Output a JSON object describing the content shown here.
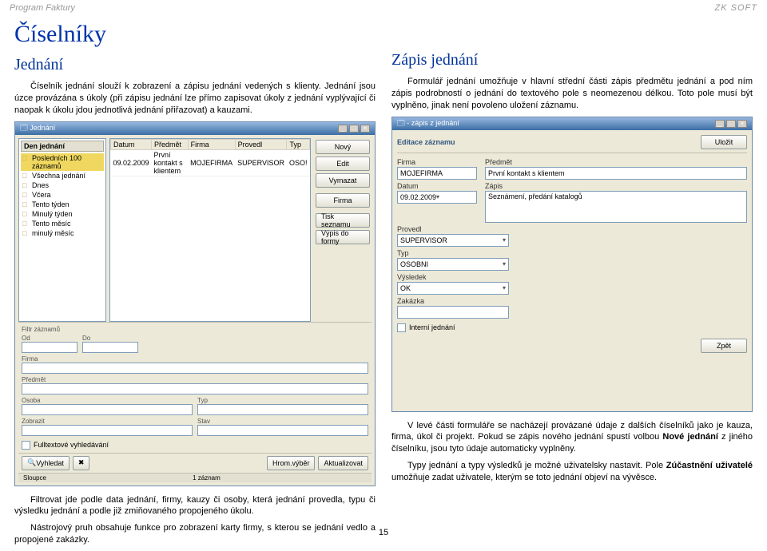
{
  "header": {
    "left": "Program Faktury",
    "right": "ZK SOFT"
  },
  "page_number": "15",
  "left_col": {
    "h1": "Číselníky",
    "h2": "Jednání",
    "p1": "Číselník jednání slouží k zobrazení a zápisu jednání vedených s klienty. Jednání jsou úzce provázána s úkoly (při zápisu jednání lze přímo zapisovat úkoly z jednání vyplývající či naopak k úkolu jdou jednotlivá jednání přiřazovat) a kauzami.",
    "p2": "Filtrovat jde podle data jednání, firmy, kauzy či osoby, která jednání provedla, typu či výsledku jednání a podle již zmiňovaného propojeného úkolu.",
    "p3": "Nástrojový pruh obsahuje funkce pro zobrazení karty firmy, s kterou se jednání vedlo a propojené zakázky."
  },
  "right_col": {
    "h2": "Zápis jednání",
    "p1": "Formulář jednání umožňuje v hlavní střední části zápis předmětu jednání a pod ním zápis podrobností o jednání do textového pole s neomezenou délkou. Toto pole musí být vyplněno, jinak není povoleno uložení záznamu.",
    "p2a": "V levé části formuláře se nacházejí provázané údaje z dalších číselníků jako je kauza, firma, úkol či projekt. Pokud se zápis nového jednání spustí volbou ",
    "p2b": "Nové jednání",
    "p2c": " z jiného číselníku, jsou tyto údaje automaticky vyplněny.",
    "p3a": "Typy jednání a typy výsledků je možné uživatelsky nastavit. Pole ",
    "p3b": "Zúčastnění uživatelé",
    "p3c": " umožňuje zadat uživatele, kterým se toto jednání objeví na vývěsce."
  },
  "win1": {
    "title": "Jednání",
    "tree": {
      "hdr": "Den jednání",
      "items": [
        "Posledních 100 záznamů",
        "Všechna jednání",
        "Dnes",
        "Včera",
        "Tento týden",
        "Minulý týden",
        "Tento měsíc",
        "minulý měsíc"
      ]
    },
    "grid": {
      "headers": [
        "Datum",
        "Předmět",
        "Firma",
        "Provedl",
        "Typ"
      ],
      "row": [
        "09.02.2009",
        "První kontakt s klientem",
        "MOJEFIRMA",
        "SUPERVISOR",
        "OSO!"
      ]
    },
    "sidebtns": [
      "Nový",
      "Edit",
      "Vymazat",
      "Firma",
      "Tisk seznamu",
      "Výpis do formy"
    ],
    "filters": {
      "hdr": "Filtr záznamů",
      "labels": {
        "od": "Od",
        "do": "Do",
        "firma": "Firma",
        "predmet": "Předmět",
        "osoba": "Osoba",
        "typ": "Typ",
        "zobrazit": "Zobrazit",
        "stav": "Stav"
      },
      "fulltext": "Fulltextové vyhledávání"
    },
    "bottom": {
      "vyhledat": "Vyhledat",
      "hromvyber": "Hrom.výběr",
      "aktualizovat": "Aktualizovat"
    },
    "status": {
      "sloupce": "Sloupce",
      "zaznam": "1 záznam"
    }
  },
  "win2": {
    "title": "- zápis z jednání",
    "editace": "Editace záznamu",
    "ulozit": "Uložit",
    "labels": {
      "firma": "Firma",
      "predmet": "Předmět",
      "datum": "Datum",
      "zapis": "Zápis",
      "provedl": "Provedl",
      "typ": "Typ",
      "vysledek": "Výsledek",
      "zakazka": "Zakázka",
      "interni": "Interní jednání",
      "zpet": "Zpět"
    },
    "values": {
      "firma": "MOJEFIRMA",
      "predmet": "První kontakt s klientem",
      "datum": "09.02.2009",
      "zapis": "Seznámení, předání katalogů",
      "provedl": "SUPERVISOR",
      "typ": "OSOBNI",
      "vysledek": "OK"
    }
  }
}
